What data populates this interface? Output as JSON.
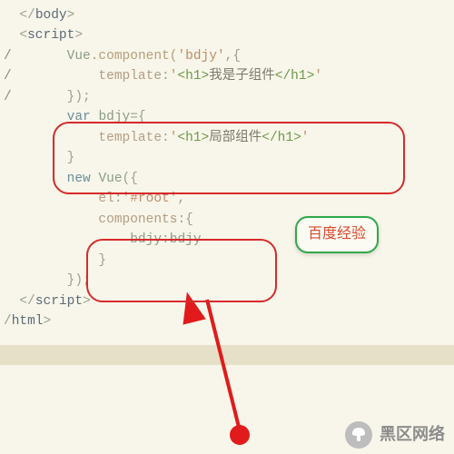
{
  "code": {
    "l1_body_close": "</body>",
    "l2_script_open": "<script>",
    "l3_comment": "Vue.component('bdjy',{",
    "l3_vue": "Vue",
    "l3_method": ".component(",
    "l3_arg": "'bdjy'",
    "l3_tail": ",{",
    "l4_key": "template",
    "l4_val_open": "'<h1>",
    "l4_text": "我是子组件",
    "l4_val_close": "</h1>'",
    "l5_close": "});",
    "l6_var": "var",
    "l6_name": "bdjy",
    "l6_eq": "={",
    "l7_key": "template",
    "l7_val_open": "'<h1>",
    "l7_text": "局部组件",
    "l7_val_close": "</h1>'",
    "l8_brace": "}",
    "l9_new": "new",
    "l9_vue": "Vue",
    "l9_open": "({",
    "l10_key": "el",
    "l10_val": "'#root'",
    "l10_comma": ",",
    "l11_key": "components",
    "l11_open": ":{",
    "l12_k": "bdjy",
    "l12_sep": ":",
    "l12_v": "bdjy",
    "l13_brace": "}",
    "l14_close": "});",
    "l15_script_close": "</​script>",
    "l16_html_close": "/html>"
  },
  "callout": {
    "label": "百度经验"
  },
  "brand": {
    "name": "黑区网络"
  },
  "colors": {
    "highlight_border": "#d62a2a",
    "callout_border": "#2fa84a",
    "callout_text": "#d94a2a",
    "arrow": "#e11b1b",
    "background": "#f8f6ea"
  }
}
